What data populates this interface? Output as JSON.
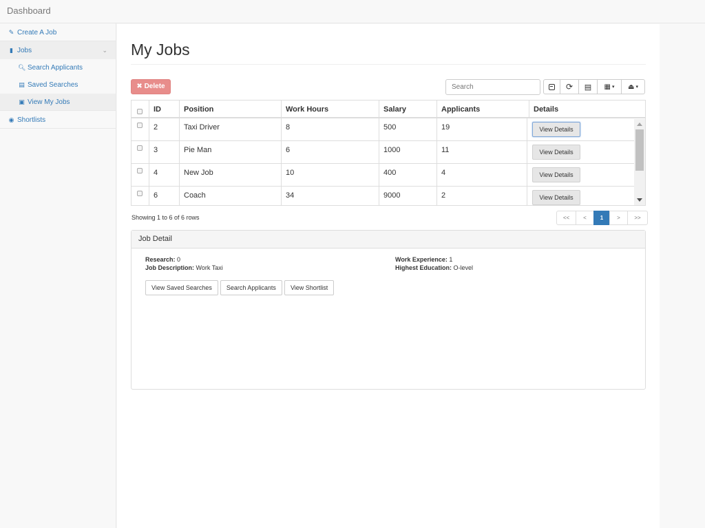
{
  "app": {
    "title": "Dashboard"
  },
  "sidebar": {
    "items": [
      {
        "label": "Create A Job",
        "icon": "edit-icon"
      },
      {
        "label": "Jobs",
        "icon": "book-icon"
      },
      {
        "label": "Search Applicants",
        "icon": "search-icon"
      },
      {
        "label": "Saved Searches",
        "icon": "archive-icon"
      },
      {
        "label": "View My Jobs",
        "icon": "briefcase-icon"
      },
      {
        "label": "Shortlists",
        "icon": "eye-icon"
      }
    ]
  },
  "main": {
    "title": "My Jobs",
    "delete_label": "Delete",
    "search_placeholder": "Search",
    "toolbar_icons": [
      "toggle-icon",
      "refresh-icon",
      "columns-icon",
      "grid-icon",
      "export-icon"
    ]
  },
  "table": {
    "columns": [
      "ID",
      "Position",
      "Work Hours",
      "Salary",
      "Applicants",
      "Details"
    ],
    "rows": [
      {
        "id": "2",
        "position": "Taxi Driver",
        "hours": "8",
        "salary": "500",
        "applicants": "19",
        "details": "View Details"
      },
      {
        "id": "3",
        "position": "Pie Man",
        "hours": "6",
        "salary": "1000",
        "applicants": "11",
        "details": "View Details"
      },
      {
        "id": "4",
        "position": "New Job",
        "hours": "10",
        "salary": "400",
        "applicants": "4",
        "details": "View Details"
      },
      {
        "id": "6",
        "position": "Coach",
        "hours": "34",
        "salary": "9000",
        "applicants": "2",
        "details": "View Details"
      }
    ],
    "showing": "Showing 1 to 6 of 6 rows",
    "pagination": [
      "<<",
      "<",
      "1",
      ">",
      ">>"
    ]
  },
  "job_detail": {
    "heading": "Job Detail",
    "research_label": "Research:",
    "research_value": "0",
    "description_label": "Job Description:",
    "description_value": "Work Taxi",
    "experience_label": "Work Experience:",
    "experience_value": "1",
    "education_label": "Highest Education:",
    "education_value": "O-level",
    "buttons": [
      "View Saved Searches",
      "Search Applicants",
      "View Shortlist"
    ]
  },
  "colors": {
    "link": "#337ab7",
    "danger": "#e88d8b",
    "active_page": "#337ab7"
  }
}
